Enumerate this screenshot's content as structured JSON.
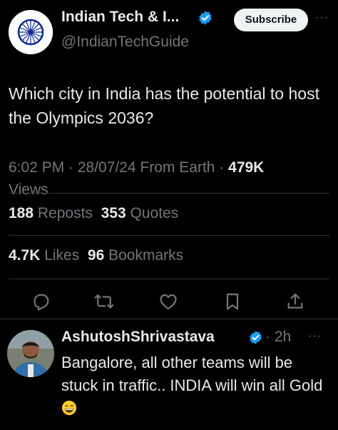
{
  "account": {
    "name": "Indian Tech & I...",
    "handle": "@IndianTechGuide",
    "subscribe_label": "Subscribe",
    "more_label": "···"
  },
  "tweet": {
    "text": "Which city in India has the potential to host the Olympics 2036?",
    "meta_prefix": "6:02 PM · 28/07/24 From Earth · ",
    "views_count": "479K",
    "views_label": "Views"
  },
  "stats": {
    "reposts_count": "188",
    "reposts_label": "Reposts",
    "quotes_count": "353",
    "quotes_label": "Quotes",
    "likes_count": "4.7K",
    "likes_label": "Likes",
    "bookmarks_count": "96",
    "bookmarks_label": "Bookmarks"
  },
  "actions": [
    "reply-icon",
    "repost-icon",
    "like-icon",
    "bookmark-icon",
    "share-icon"
  ],
  "reply": {
    "name": "AshutoshShrivastava",
    "time": "· 2h",
    "more_label": "···",
    "text": "Bangalore, all other teams will be stuck in traffic.. INDIA will win all Gold"
  },
  "colors": {
    "background": "#000000",
    "text_primary": "#e7e9ea",
    "text_secondary": "#71767b",
    "divider": "#2f3336",
    "verified": "#1d9bf0"
  }
}
